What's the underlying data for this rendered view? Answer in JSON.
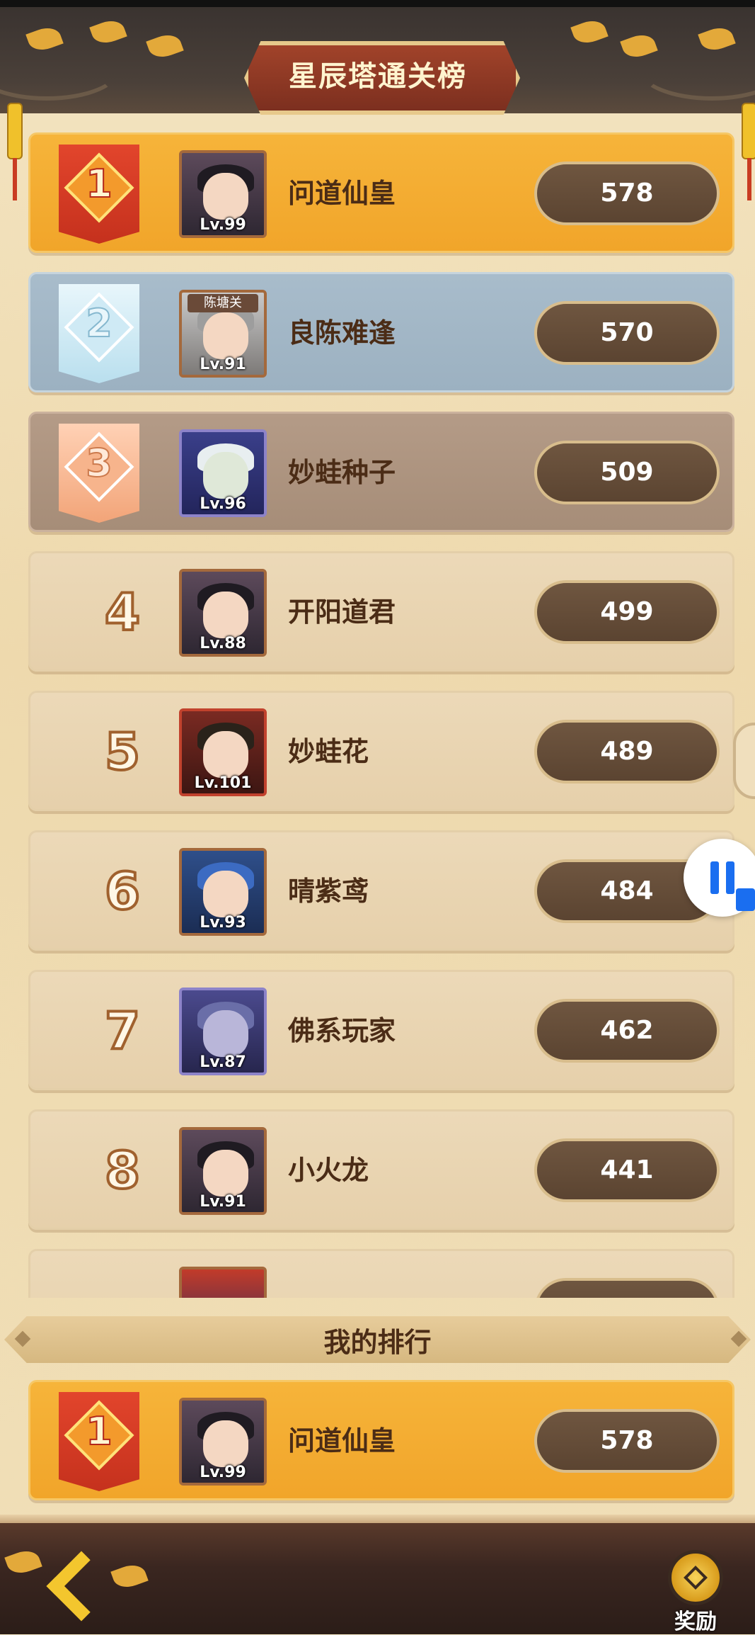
{
  "header": {
    "title": "星辰塔通关榜"
  },
  "rows": [
    {
      "rank": "1",
      "name": "问道仙皇",
      "level": "Lv.99",
      "score": "578",
      "tag": ""
    },
    {
      "rank": "2",
      "name": "良陈难逢",
      "level": "Lv.91",
      "score": "570",
      "tag": "陈塘关"
    },
    {
      "rank": "3",
      "name": "妙蛙种子",
      "level": "Lv.96",
      "score": "509",
      "tag": ""
    },
    {
      "rank": "4",
      "name": "开阳道君",
      "level": "Lv.88",
      "score": "499",
      "tag": ""
    },
    {
      "rank": "5",
      "name": "妙蛙花",
      "level": "Lv.101",
      "score": "489",
      "tag": ""
    },
    {
      "rank": "6",
      "name": "晴紫鸢",
      "level": "Lv.93",
      "score": "484",
      "tag": ""
    },
    {
      "rank": "7",
      "name": "佛系玩家",
      "level": "Lv.87",
      "score": "462",
      "tag": ""
    },
    {
      "rank": "8",
      "name": "小火龙",
      "level": "Lv.91",
      "score": "441",
      "tag": ""
    }
  ],
  "my_rank": {
    "section_title": "我的排行",
    "rank": "1",
    "name": "问道仙皇",
    "level": "Lv.99",
    "score": "578"
  },
  "footer": {
    "reward_label": "奖励"
  },
  "colors": {
    "gold": "#f1a52a",
    "silver": "#9cb1c1",
    "bronze": "#a68d78",
    "plain": "#e6d0ab",
    "score_bg": "#5b4431"
  }
}
